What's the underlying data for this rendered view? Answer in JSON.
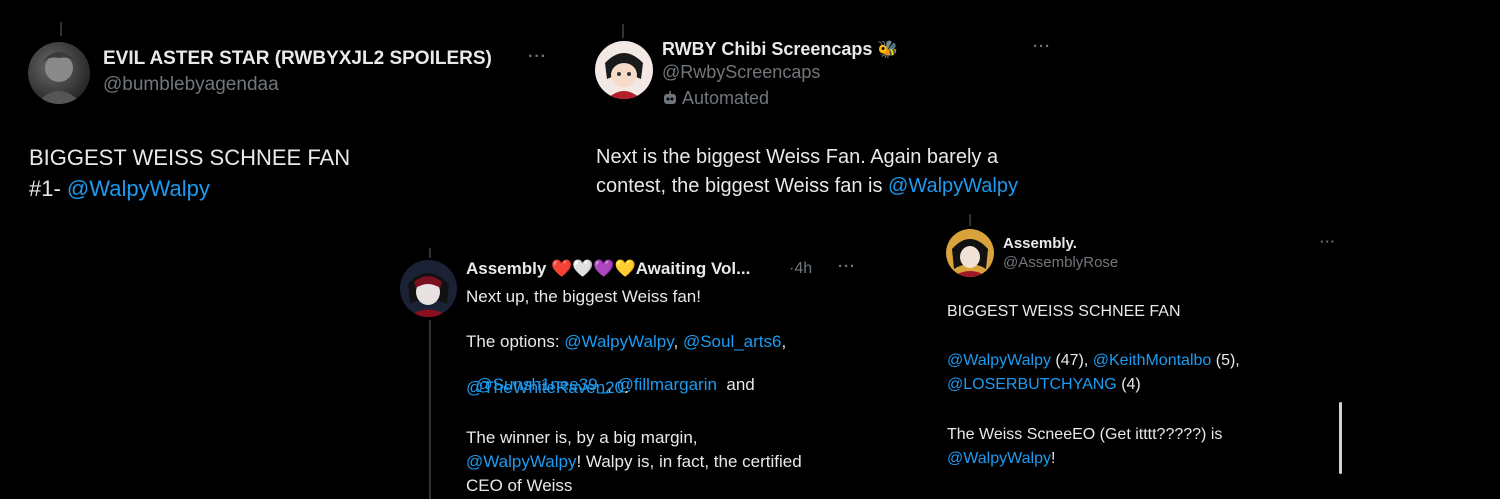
{
  "tweet1": {
    "name": "EVIL ASTER STAR (RWBYXJL2 SPOILERS)",
    "handle": "@bumblebyagendaa",
    "more": "···",
    "line1": "BIGGEST WEISS SCHNEE FAN",
    "line2_prefix": "#1- ",
    "mention": "@WalpyWalpy"
  },
  "tweet2": {
    "name": "RWBY Chibi Screencaps",
    "emoji": "🐝",
    "handle": "@RwbyScreencaps",
    "automated_label": "Automated",
    "more": "···",
    "line1": "Next is the biggest Weiss Fan. Again barely a",
    "line2_prefix": "contest, the biggest Weiss fan is ",
    "mention": "@WalpyWalpy"
  },
  "tweet3": {
    "name": "Assembly ❤️🤍💜💛Awaiting Vol...",
    "dot": "·",
    "time": "4h",
    "more": "···",
    "line1": "Next up, the biggest Weiss fan!",
    "options_prefix": "The options: ",
    "m1": "@WalpyWalpy",
    "sep1": ", ",
    "m2": "@Soul_arts6",
    "sep2": ",",
    "m3": "@Sunsh1nee39_",
    "sep3": ", ",
    "m4": "@fillmargarin",
    "and": "  and",
    "m5": "@TheWhiteRaven20",
    "period": ".",
    "winner_line": "The winner is, by a big margin,",
    "m6": "@WalpyWalpy",
    "winner_rest": "! Walpy is, in fact, the certified",
    "last_line": "CEO of Weiss"
  },
  "tweet4": {
    "name": "Assembly.",
    "handle": "@AssemblyRose",
    "more": "···",
    "line1": "BIGGEST WEISS SCHNEE FAN",
    "m1": "@WalpyWalpy",
    "c1": " (47), ",
    "m2": "@KeithMontalbo",
    "c2": " (5),",
    "m3": "@LOSERBUTCHYANG",
    "c3": " (4)",
    "line5": "The Weiss ScneeEO (Get itttt?????) is",
    "m4": "@WalpyWalpy",
    "end": "!"
  }
}
